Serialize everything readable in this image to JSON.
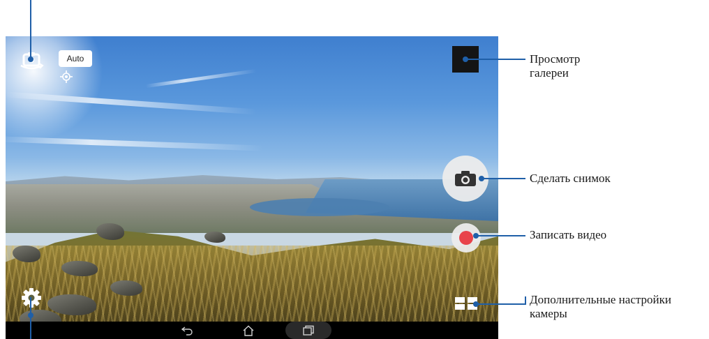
{
  "camera": {
    "scene_mode": "Auto",
    "icons": {
      "switch_camera": "switch-camera-icon",
      "focus": "focus-icon",
      "settings": "gear-icon",
      "shutter": "camera-icon",
      "record": "record-dot-icon",
      "more_settings": "grid-icon"
    },
    "accent_color": "#e8434a"
  },
  "navbar": {
    "back_icon": "back-icon",
    "home_icon": "home-icon",
    "recent_icon": "recent-apps-icon"
  },
  "callouts": {
    "gallery": [
      "Просмотр",
      "галереи"
    ],
    "shutter": "Сделать снимок",
    "record": "Записать видео",
    "more_settings": [
      "Дополнительные настройки",
      "камеры"
    ]
  },
  "colors": {
    "callout_line": "#1f5fa8"
  }
}
